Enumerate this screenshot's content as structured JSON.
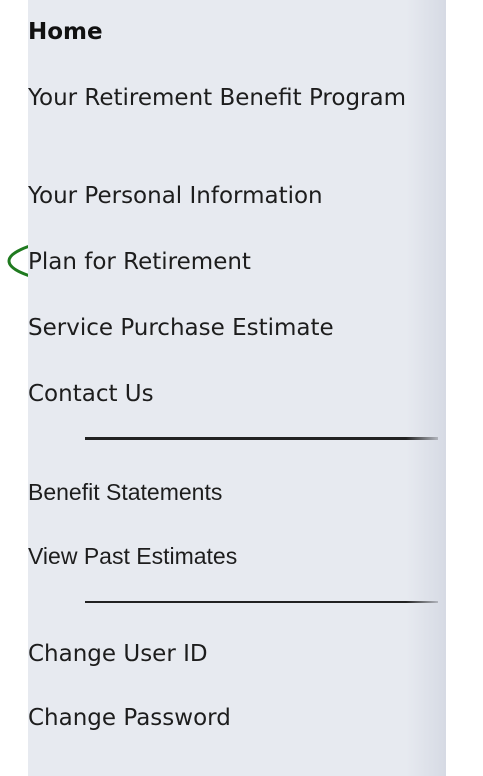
{
  "nav": {
    "home": "Home",
    "items": [
      {
        "label": "Your Retirement Benefit Program"
      },
      {
        "label": "Your Personal Information"
      },
      {
        "label": "Plan for Retirement"
      },
      {
        "label": "Service Purchase Estimate"
      },
      {
        "label": "Contact Us"
      },
      {
        "label": "Benefit Statements"
      },
      {
        "label": "View Past Estimates"
      },
      {
        "label": "Change User ID"
      },
      {
        "label": "Change Password"
      }
    ]
  },
  "colors": {
    "sidebar_bg": "#e7eaf0",
    "text": "#1d1d1d",
    "highlight": "#1f7a1f"
  }
}
